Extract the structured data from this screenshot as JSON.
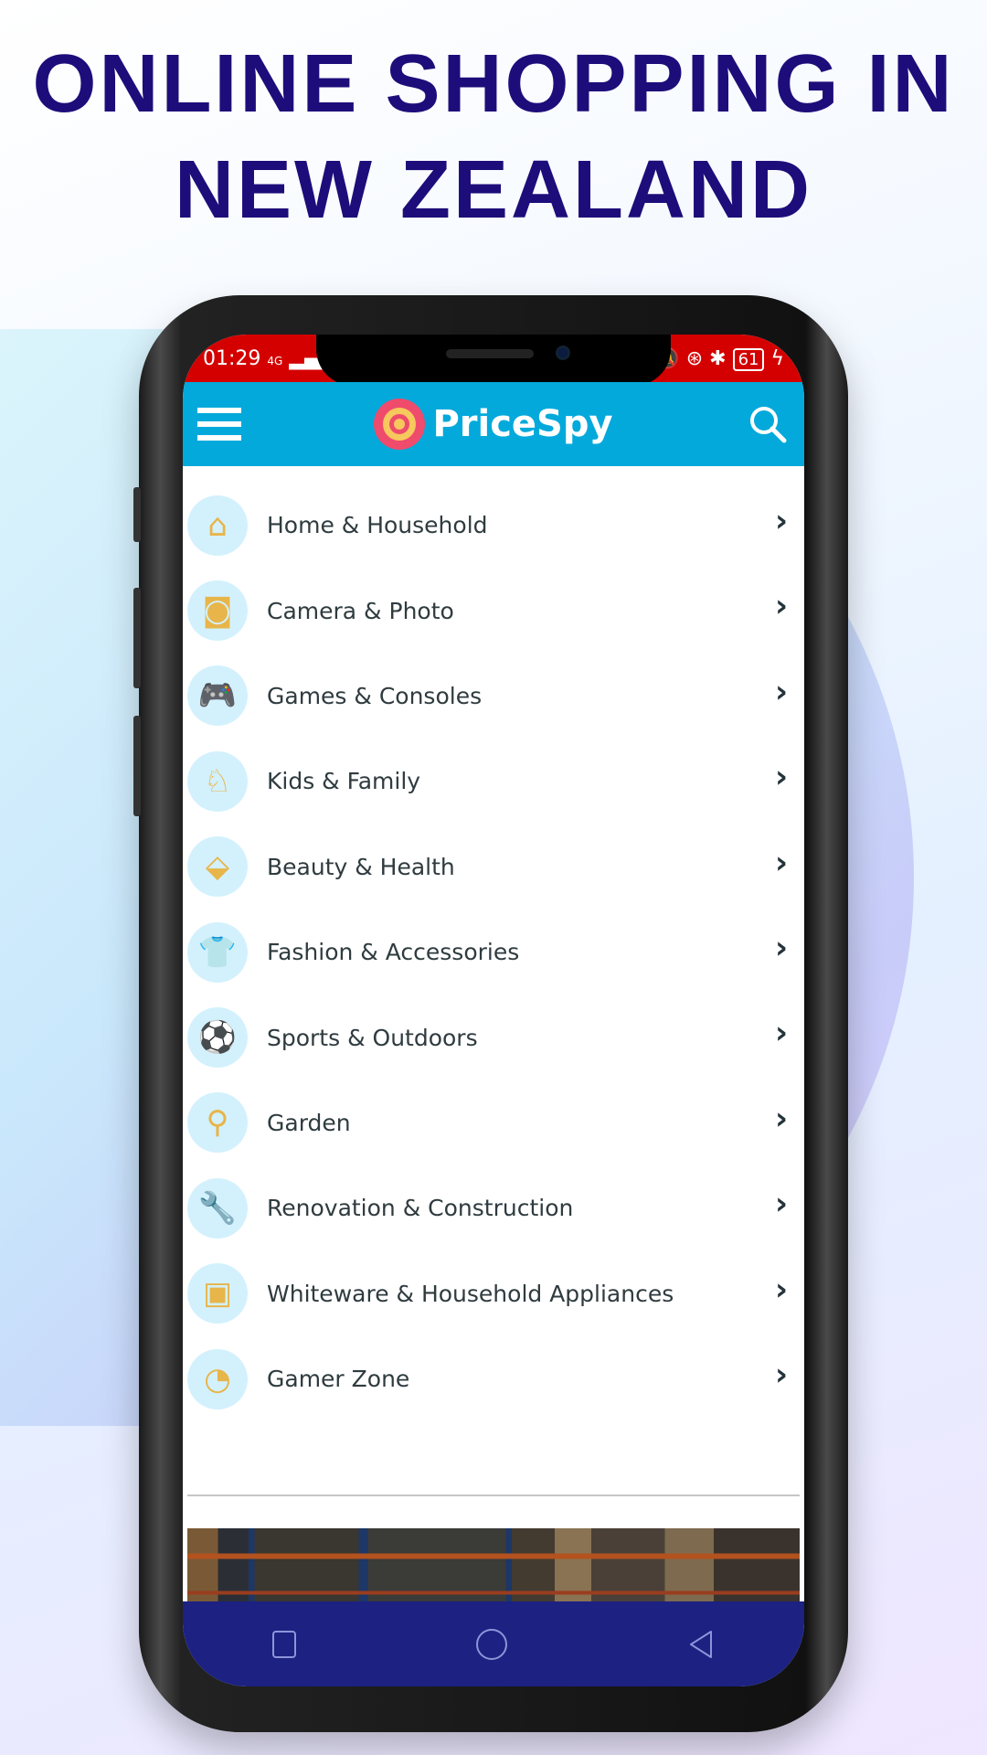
{
  "headline": {
    "line1": "ONLINE SHOPPING IN",
    "line2": "NEW ZEALAND"
  },
  "status_bar": {
    "time": "01:29",
    "network": "4G",
    "battery": "61",
    "color": "#d40000"
  },
  "app_bar": {
    "brand": "PriceSpy",
    "color": "#03a9db",
    "menu_icon": "hamburger-icon",
    "search_icon": "search-icon"
  },
  "categories": [
    {
      "label": "Home & Household",
      "icon": "house-icon",
      "glyph": "⌂"
    },
    {
      "label": "Camera & Photo",
      "icon": "camera-icon",
      "glyph": "◙"
    },
    {
      "label": "Games & Consoles",
      "icon": "gamepad-icon",
      "glyph": "🎮"
    },
    {
      "label": "Kids & Family",
      "icon": "rocking-horse-icon",
      "glyph": "♘"
    },
    {
      "label": "Beauty & Health",
      "icon": "perfume-icon",
      "glyph": "⬙"
    },
    {
      "label": "Fashion & Accessories",
      "icon": "shirt-icon",
      "glyph": "👕"
    },
    {
      "label": "Sports & Outdoors",
      "icon": "soccer-ball-icon",
      "glyph": "⚽"
    },
    {
      "label": "Garden",
      "icon": "shovel-icon",
      "glyph": "⚲"
    },
    {
      "label": "Renovation & Construction",
      "icon": "tools-icon",
      "glyph": "🔧"
    },
    {
      "label": "Whiteware & Household Appliances",
      "icon": "washing-machine-icon",
      "glyph": "▣"
    },
    {
      "label": "Gamer Zone",
      "icon": "pacman-icon",
      "glyph": "◔"
    }
  ],
  "chevron": "›",
  "nav_bar": {
    "color": "#1c2182",
    "buttons": [
      "recents",
      "home",
      "back"
    ]
  }
}
